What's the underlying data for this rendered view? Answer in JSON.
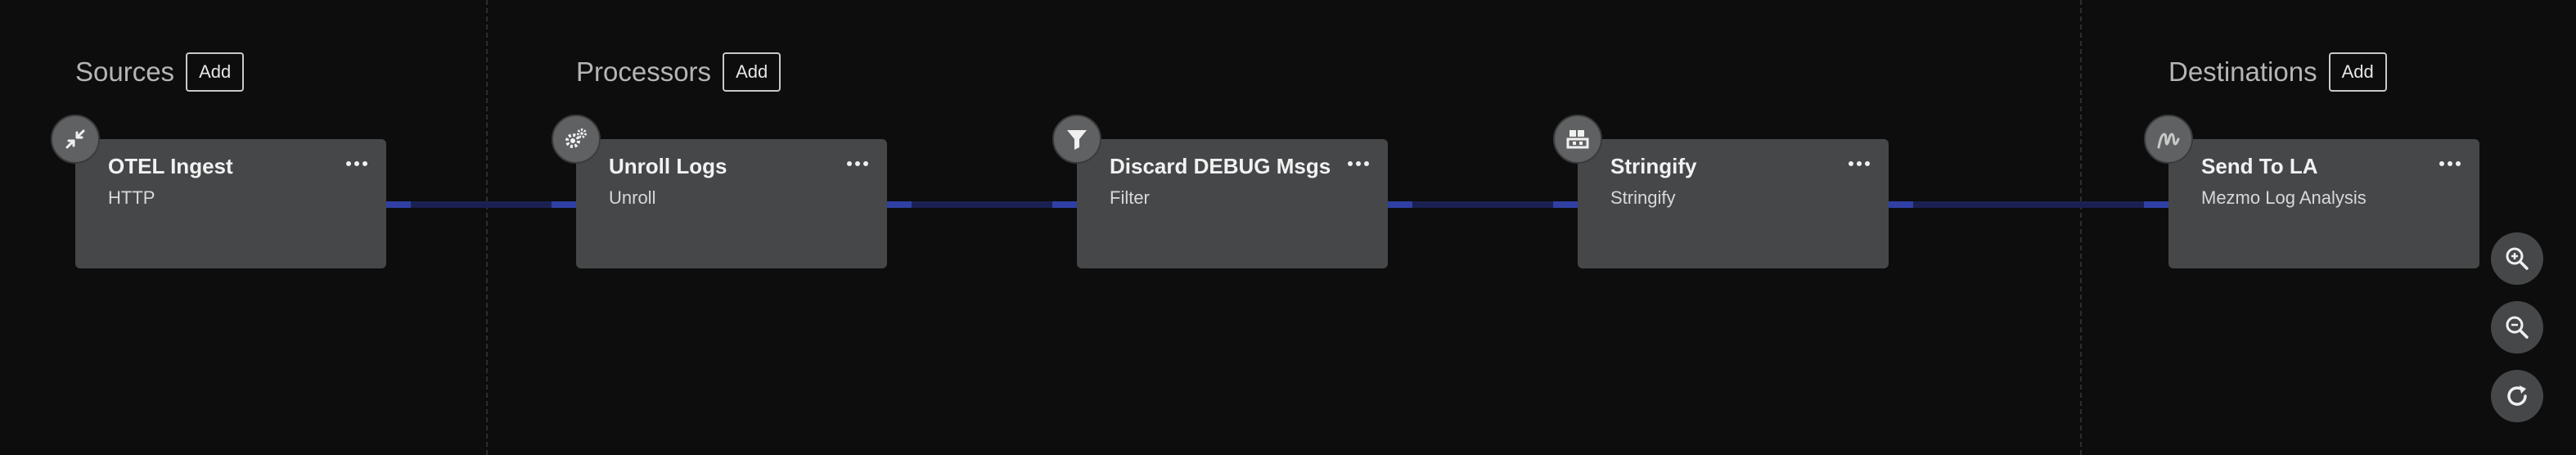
{
  "sections": {
    "sources": {
      "title": "Sources",
      "add_label": "Add"
    },
    "processors": {
      "title": "Processors",
      "add_label": "Add"
    },
    "destinations": {
      "title": "Destinations",
      "add_label": "Add"
    }
  },
  "nodes": [
    {
      "title": "OTEL Ingest",
      "subtitle": "HTTP",
      "icon": "compress-arrows-icon"
    },
    {
      "title": "Unroll Logs",
      "subtitle": "Unroll",
      "icon": "gears-icon"
    },
    {
      "title": "Discard DEBUG Msgs",
      "subtitle": "Filter",
      "icon": "filter-icon"
    },
    {
      "title": "Stringify",
      "subtitle": "Stringify",
      "icon": "blocks-icon"
    },
    {
      "title": "Send To LA",
      "subtitle": "Mezmo Log Analysis",
      "icon": "mezmo-logo-icon"
    }
  ],
  "zoom_controls": [
    "zoom-in-icon",
    "zoom-out-icon",
    "reset-view-icon"
  ],
  "colors": {
    "background": "#0d0d0d",
    "node": "#454749",
    "connector": "#1a2152",
    "connector_accent": "#2f3fa3"
  }
}
